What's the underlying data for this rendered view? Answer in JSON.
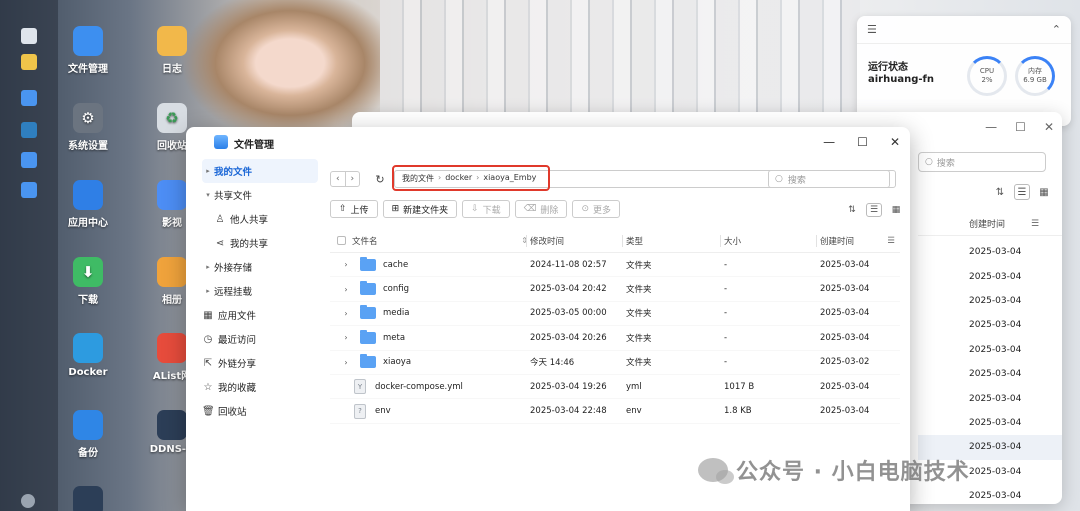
{
  "desktop": {
    "icons": [
      {
        "label": "文件管理",
        "icon": "folder-app-icon",
        "color": "#3d8ff0"
      },
      {
        "label": "日志",
        "icon": "log-icon",
        "color": "#f2b84a"
      },
      {
        "label": "系统设置",
        "icon": "gear-icon",
        "color": "#6b7480"
      },
      {
        "label": "回收站",
        "icon": "recycle-icon",
        "color": "#d8dde3"
      },
      {
        "label": "应用中心",
        "icon": "store-icon",
        "color": "#2f7fe6"
      },
      {
        "label": "影视",
        "icon": "video-icon",
        "color": "#4d8ef5"
      },
      {
        "label": "下载",
        "icon": "download-icon",
        "color": "#3fbb65"
      },
      {
        "label": "相册",
        "icon": "photos-icon",
        "color": "#f0a33c"
      },
      {
        "label": "Docker",
        "icon": "docker-icon",
        "color": "#2d9be0"
      },
      {
        "label": "AList网",
        "icon": "alist-icon",
        "color": "#e74c3c"
      },
      {
        "label": "备份",
        "icon": "backup-icon",
        "color": "#2f86e6"
      },
      {
        "label": "DDNS-G",
        "icon": "ddns-icon",
        "color": "#2c3e57"
      }
    ]
  },
  "widget": {
    "title": "运行状态",
    "host": "airhuang-fn",
    "cpu_label": "CPU",
    "cpu_value": "2%",
    "mem_label": "内存",
    "mem_value": "6.9 GB"
  },
  "back_window": {
    "search_placeholder": "搜索",
    "column_header": "创建时间",
    "dates": [
      "2025-03-04",
      "2025-03-04",
      "2025-03-04",
      "2025-03-04",
      "2025-03-04",
      "2025-03-04",
      "2025-03-04",
      "2025-03-04",
      "2025-03-04",
      "2025-03-04",
      "2025-03-04"
    ]
  },
  "window": {
    "title": "文件管理",
    "sidebar": {
      "my_files": "我的文件",
      "shared_files": "共享文件",
      "others_shared": "他人共享",
      "my_shared": "我的共享",
      "external_storage": "外接存储",
      "remote_mount": "远程挂载",
      "app_files": "应用文件",
      "recent": "最近访问",
      "link_share": "外链分享",
      "favorites": "我的收藏",
      "recycle": "回收站"
    },
    "breadcrumb": [
      "我的文件",
      "docker",
      "xiaoya_Emby"
    ],
    "search_placeholder": "搜索",
    "toolbar": {
      "upload": "上传",
      "new_folder": "新建文件夹",
      "download": "下载",
      "delete": "删除",
      "more": "更多"
    },
    "columns": {
      "name": "文件名",
      "modified": "修改时间",
      "type": "类型",
      "size": "大小",
      "created": "创建时间"
    },
    "rows": [
      {
        "name": "cache",
        "modified": "2024-11-08 02:57",
        "type": "文件夹",
        "size": "-",
        "created": "2025-03-04",
        "kind": "folder"
      },
      {
        "name": "config",
        "modified": "2025-03-04 20:42",
        "type": "文件夹",
        "size": "-",
        "created": "2025-03-04",
        "kind": "folder"
      },
      {
        "name": "media",
        "modified": "2025-03-05 00:00",
        "type": "文件夹",
        "size": "-",
        "created": "2025-03-04",
        "kind": "folder"
      },
      {
        "name": "meta",
        "modified": "2025-03-04 20:26",
        "type": "文件夹",
        "size": "-",
        "created": "2025-03-04",
        "kind": "folder"
      },
      {
        "name": "xiaoya",
        "modified": "今天 14:46",
        "type": "文件夹",
        "size": "-",
        "created": "2025-03-02",
        "kind": "folder"
      },
      {
        "name": "docker-compose.yml",
        "modified": "2025-03-04 19:26",
        "type": "yml",
        "size": "1017 B",
        "created": "2025-03-04",
        "kind": "file"
      },
      {
        "name": "env",
        "modified": "2025-03-04 22:48",
        "type": "env",
        "size": "1.8 KB",
        "created": "2025-03-04",
        "kind": "file"
      }
    ]
  },
  "watermark": "公众号 · 小白电脑技术"
}
